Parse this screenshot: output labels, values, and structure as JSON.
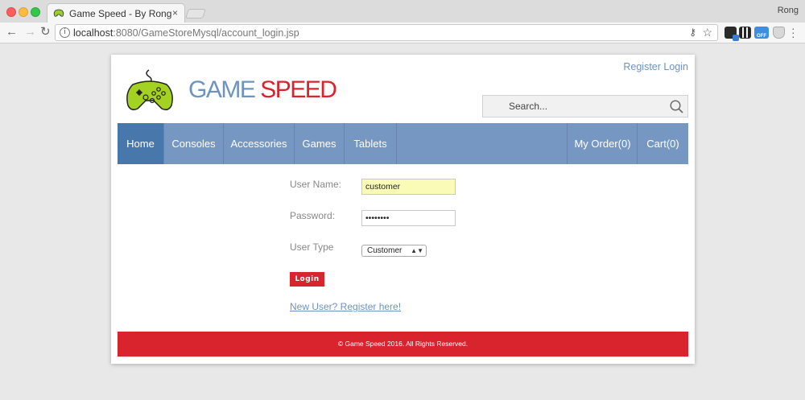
{
  "browser": {
    "tab_title": "Game Speed - By Rong",
    "tab_close": "×",
    "profile_name": "Rong",
    "url_host": "localhost",
    "url_rest": ":8080/GameStoreMysql/account_login.jsp",
    "ext3_label": "OFF"
  },
  "site": {
    "title_part1": "GAME",
    "title_part2": " SPEED",
    "register_link": "Register",
    "login_link": "Login",
    "search_placeholder": "Search..."
  },
  "nav": {
    "items": [
      {
        "label": "Home"
      },
      {
        "label": "Consoles"
      },
      {
        "label": "Accessories"
      },
      {
        "label": "Games"
      },
      {
        "label": "Tablets"
      }
    ],
    "my_order": "My Order(0)",
    "cart": "Cart(0)"
  },
  "form": {
    "username_label": "User Name:",
    "username_value": "customer",
    "password_label": "Password:",
    "password_value": "customer",
    "usertype_label": "User Type",
    "usertype_selected": "Customer",
    "login_button": "Login",
    "register_link": "New User? Register here!"
  },
  "footer": {
    "text": "© Game Speed 2016. All Rights Reserved."
  },
  "colors": {
    "brand_blue": "#6d93bf",
    "brand_red": "#d9232d",
    "nav_active": "#4777ab"
  }
}
